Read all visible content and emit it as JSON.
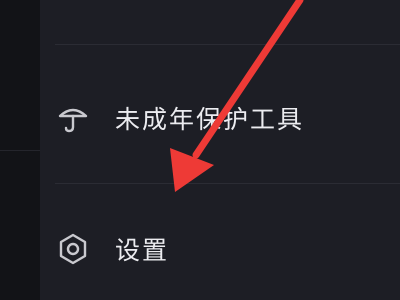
{
  "menu": {
    "items": [
      {
        "label": "未成年保护工具",
        "icon": "umbrella-icon"
      },
      {
        "label": "设置",
        "icon": "gear-icon"
      }
    ]
  },
  "colors": {
    "background": "#1d1e25",
    "left_strip": "#121317",
    "text": "#ececf0",
    "icon": "#c9c9cf",
    "annotation_arrow": "#ee3a36"
  }
}
